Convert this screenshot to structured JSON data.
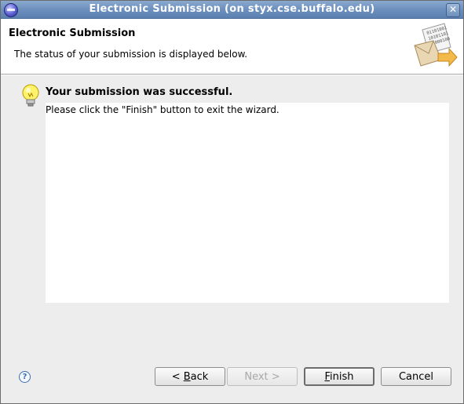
{
  "window": {
    "title": "Electronic Submission  (on styx.cse.buffalo.edu)",
    "close_glyph": "✕"
  },
  "header": {
    "title": "Electronic Submission",
    "description": "The status of your submission is displayed below.",
    "graphic_icon": "submit-wizard-graphic-icon",
    "graphic_lines": [
      "01101001",
      "10101101",
      "11000100"
    ]
  },
  "message": {
    "icon": "lightbulb-icon",
    "title": "Your submission was successful.",
    "body": "Please click the \"Finish\" button to exit the wizard."
  },
  "buttons": {
    "help_glyph": "?",
    "back": {
      "prefix": "< ",
      "mnemonic": "B",
      "rest": "ack",
      "enabled": true
    },
    "next": {
      "label": "Next >",
      "enabled": false
    },
    "finish": {
      "mnemonic": "F",
      "rest": "inish",
      "enabled": true,
      "default": true
    },
    "cancel": {
      "label": "Cancel",
      "enabled": true
    }
  },
  "colors": {
    "titlebar": "#6f92bf",
    "dialog_bg": "#ededed",
    "header_bg": "#ffffff"
  }
}
